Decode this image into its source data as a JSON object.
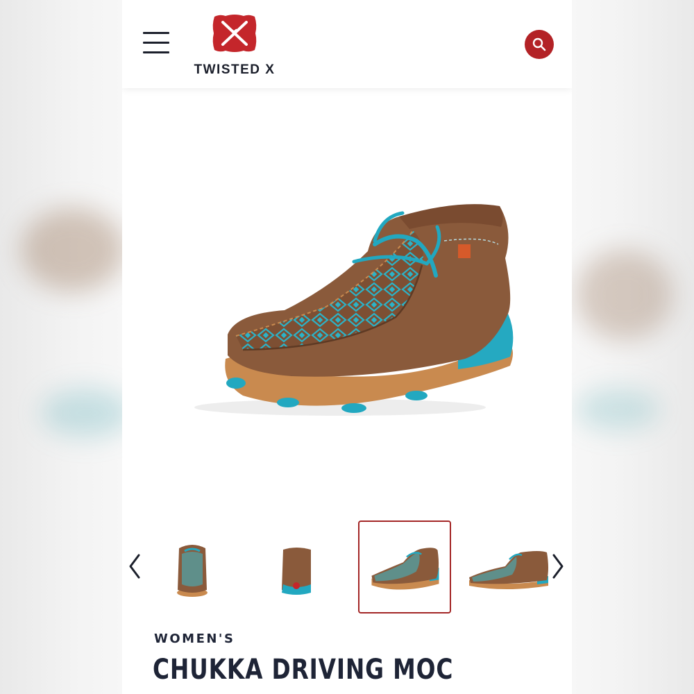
{
  "header": {
    "menu_icon": "hamburger-menu-icon",
    "logo_text": "TWISTED X",
    "search_icon": "search-icon",
    "brand_color": "#b32226"
  },
  "product": {
    "main_image": "brown-and-turquoise-chukka-driving-moc",
    "thumbnails": [
      {
        "view": "front",
        "selected": false
      },
      {
        "view": "back",
        "selected": false
      },
      {
        "view": "three-quarter",
        "selected": true
      },
      {
        "view": "side",
        "selected": false
      }
    ],
    "category": "WOMEN'S",
    "name": "CHUKKA DRIVING MOC"
  },
  "carousel": {
    "prev_icon": "chevron-left-icon",
    "next_icon": "chevron-right-icon"
  },
  "colors": {
    "leather": "#8a5a3b",
    "turquoise": "#22a8c0",
    "sole": "#c9874b",
    "text": "#1e2436",
    "selected_border": "#a32626"
  }
}
